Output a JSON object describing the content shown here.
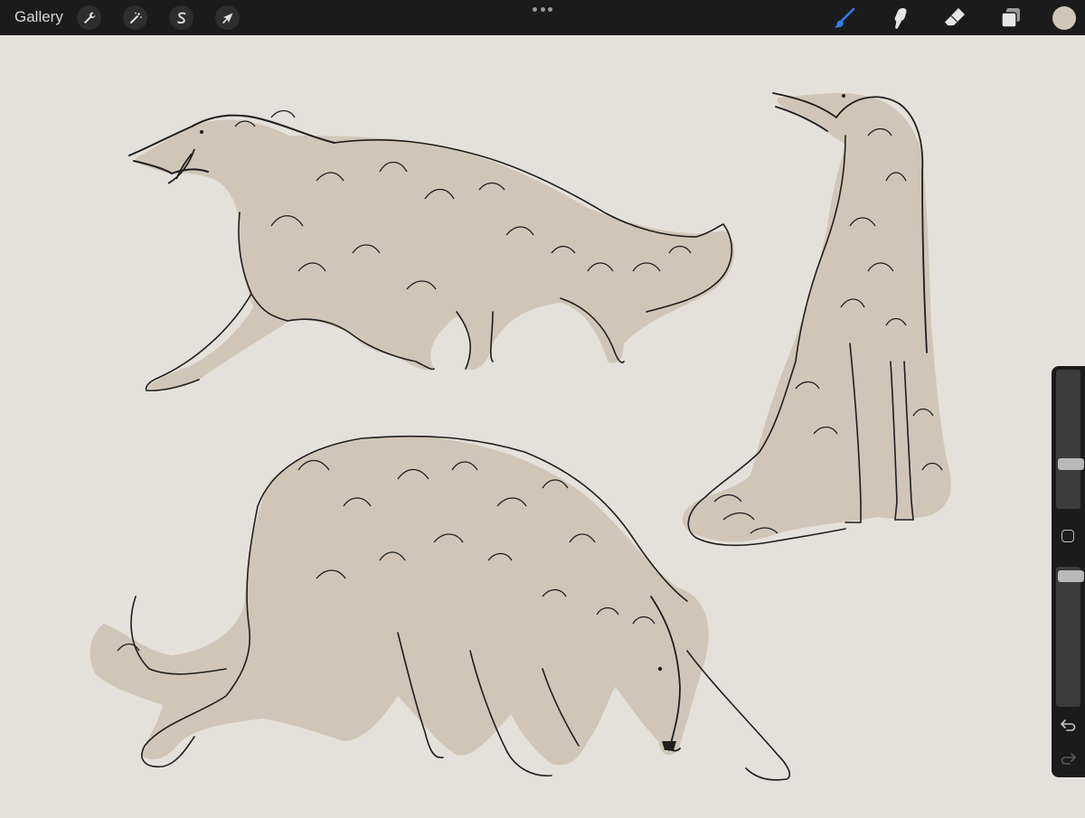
{
  "topbar": {
    "gallery_label": "Gallery",
    "left_tools": [
      {
        "name": "actions",
        "icon": "wrench-icon"
      },
      {
        "name": "adjustments",
        "icon": "magic-wand-icon"
      },
      {
        "name": "selection",
        "icon": "selection-s-icon"
      },
      {
        "name": "transform",
        "icon": "arrow-cursor-icon"
      }
    ],
    "more_icon": "ellipsis-icon",
    "right_tools": [
      {
        "name": "brush",
        "icon": "paintbrush-icon",
        "active": true,
        "color": "#2f7ff0"
      },
      {
        "name": "smudge",
        "icon": "smudge-finger-icon",
        "active": false
      },
      {
        "name": "eraser",
        "icon": "eraser-icon",
        "active": false
      },
      {
        "name": "layers",
        "icon": "layers-icon",
        "active": false
      }
    ],
    "current_color": "#d0c6b8"
  },
  "canvas": {
    "background_color": "#e4e1dc",
    "fill_color": "#d0c6b8",
    "line_color": "#1e1e1e",
    "subjects": [
      "borzoi-running-sketch",
      "borzoi-sitting-sketch",
      "borzoi-sniffing-sketch"
    ]
  },
  "sidebar": {
    "brush_size_level": 0.67,
    "opacity_level": 0.95,
    "modify_button_icon": "square-icon",
    "undo_icon": "undo-arrow-icon",
    "redo_icon": "redo-arrow-icon"
  }
}
